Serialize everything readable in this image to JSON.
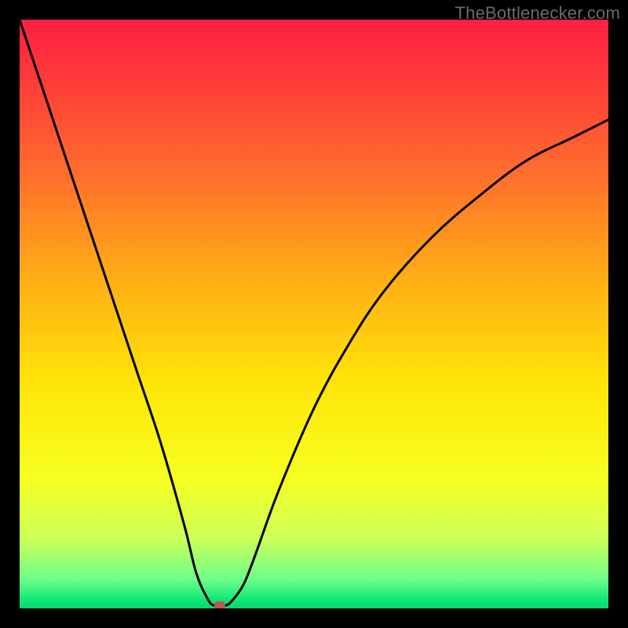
{
  "watermark": {
    "text": "TheBottlenecker.com"
  },
  "chart_data": {
    "type": "line",
    "title": "",
    "xlabel": "",
    "ylabel": "",
    "xlim": [
      0,
      100
    ],
    "ylim": [
      0,
      100
    ],
    "grid": false,
    "watermark": "TheBottlenecker.com",
    "background_gradient": {
      "stops": [
        {
          "offset": 0.0,
          "color": "#ff1f43"
        },
        {
          "offset": 0.1,
          "color": "#ff3a3a"
        },
        {
          "offset": 0.25,
          "color": "#ff6a2e"
        },
        {
          "offset": 0.45,
          "color": "#ffb115"
        },
        {
          "offset": 0.62,
          "color": "#ffe508"
        },
        {
          "offset": 0.78,
          "color": "#f6ff21"
        },
        {
          "offset": 0.88,
          "color": "#ceff58"
        },
        {
          "offset": 0.95,
          "color": "#6fff87"
        },
        {
          "offset": 0.985,
          "color": "#11e777"
        },
        {
          "offset": 1.0,
          "color": "#0bd66e"
        }
      ]
    },
    "series": [
      {
        "name": "bottleneck-curve",
        "x": [
          0,
          4,
          8,
          12,
          16,
          20,
          24,
          28,
          30,
          32,
          33,
          34,
          35,
          36,
          38,
          40,
          44,
          50,
          56,
          62,
          70,
          78,
          86,
          94,
          100
        ],
        "y": [
          100,
          88,
          76,
          64,
          52,
          40,
          28,
          14,
          6,
          1.5,
          0.5,
          0.3,
          0.5,
          1.2,
          4,
          9,
          20,
          34,
          45,
          54,
          63,
          70,
          76,
          80,
          83
        ]
      }
    ],
    "marker": {
      "name": "minimum-point",
      "x": 34,
      "y": 0.6,
      "color": "#b85a54"
    }
  }
}
